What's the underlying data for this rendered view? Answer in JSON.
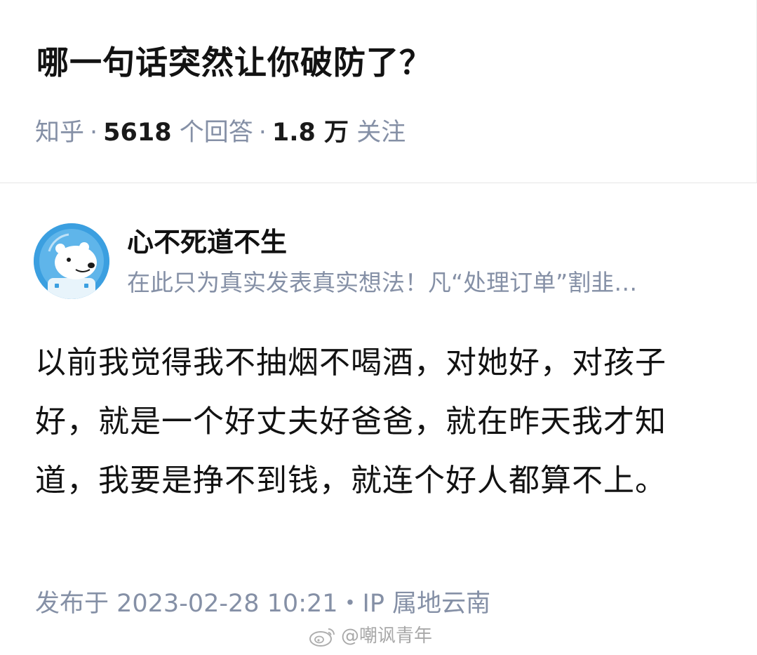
{
  "question": {
    "title": "哪一句话突然让你破防了？",
    "source": "知乎",
    "separator": "·",
    "answer_count": "5618",
    "answer_count_label": "个回答",
    "follow_count": "1.8 万",
    "follow_label": "关注"
  },
  "answer": {
    "author": {
      "name": "心不死道不生",
      "bio": "在此只为真实发表真实想法！凡“处理订单”割韭…",
      "avatar_icon": "polar-bear-astronaut-avatar"
    },
    "body": "以前我觉得我不抽烟不喝酒，对她好，对孩子好，就是一个好丈夫好爸爸，就在昨天我才知道，我要是挣不到钱，就连个好人都算不上。",
    "published": "发布于 2023-02-28 10:21・IP 属地云南"
  },
  "watermark": {
    "text": "@嘲讽青年",
    "icon": "weibo-logo-icon"
  },
  "colors": {
    "meta_gray": "#8590a6",
    "text_dark": "#121212",
    "avatar_blue": "#3b9fe0"
  }
}
